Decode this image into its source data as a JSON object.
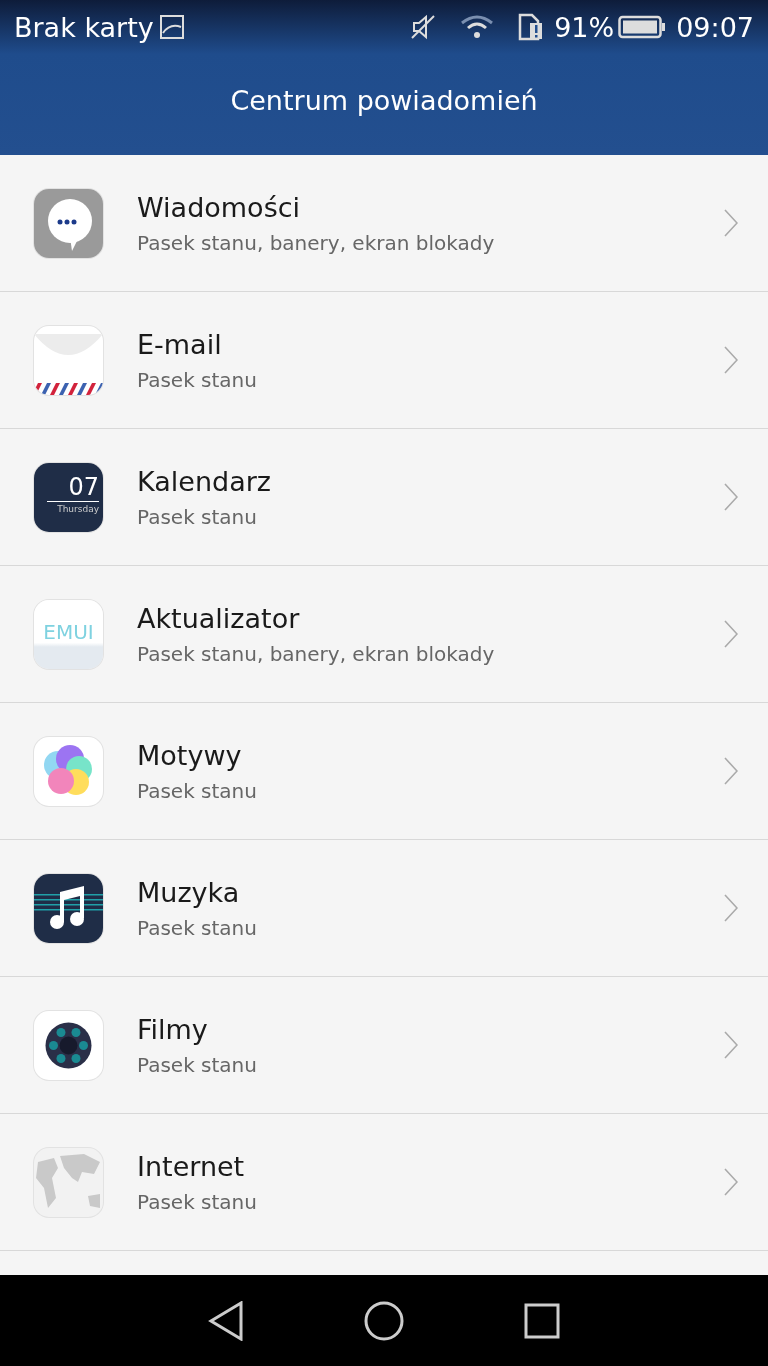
{
  "status_bar": {
    "carrier": "Brak karty",
    "battery": "91%",
    "time": "09:07"
  },
  "header": {
    "title": "Centrum powiadomień"
  },
  "apps": [
    {
      "kind": "messages",
      "name": "Wiadomości",
      "detail": "Pasek stanu, banery, ekran blokady"
    },
    {
      "kind": "email",
      "name": "E-mail",
      "detail": "Pasek stanu"
    },
    {
      "kind": "calendar",
      "name": "Kalendarz",
      "detail": "Pasek stanu",
      "icon_text": [
        "07",
        "Thursday"
      ]
    },
    {
      "kind": "updater",
      "name": "Aktualizator",
      "detail": "Pasek stanu, banery, ekran blokady",
      "icon_text": [
        "EMUI"
      ]
    },
    {
      "kind": "themes",
      "name": "Motywy",
      "detail": "Pasek stanu"
    },
    {
      "kind": "music",
      "name": "Muzyka",
      "detail": "Pasek stanu"
    },
    {
      "kind": "videos",
      "name": "Filmy",
      "detail": "Pasek stanu"
    },
    {
      "kind": "browser",
      "name": "Internet",
      "detail": "Pasek stanu"
    }
  ]
}
